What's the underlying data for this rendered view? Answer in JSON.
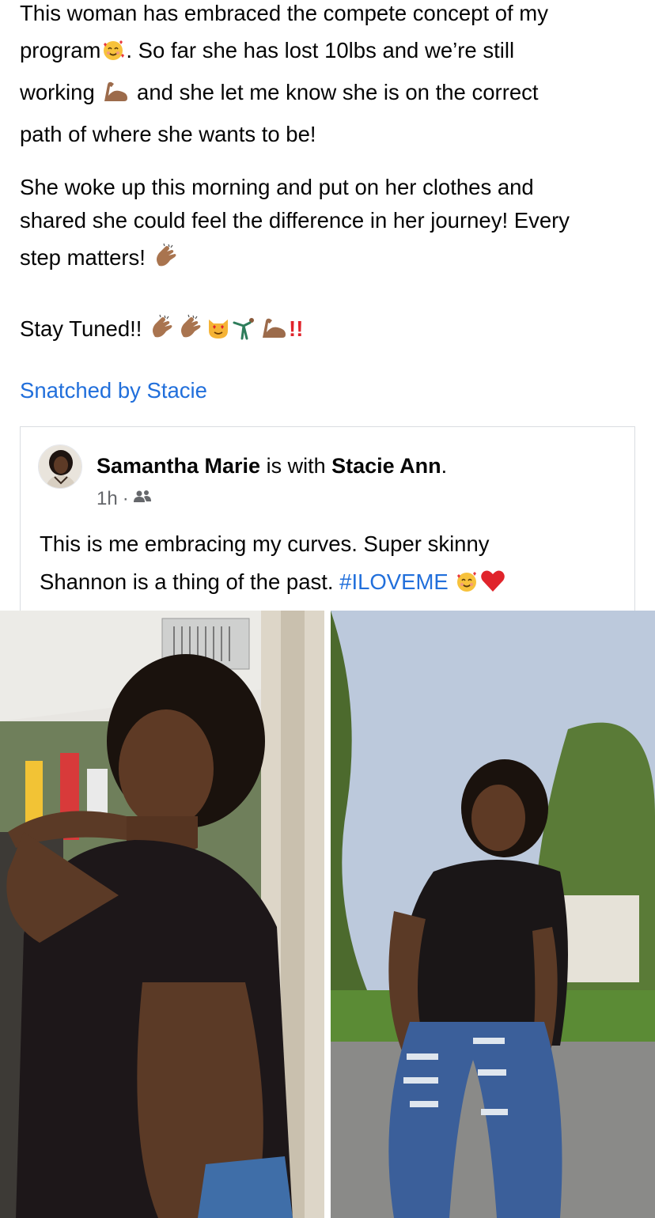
{
  "post": {
    "line1": "This woman has embraced the compete concept of my",
    "line2a": "program",
    "line2b": ". So far she has lost 10lbs and we’re still",
    "line3a": "working ",
    "line3b": " and she let me know she is on the correct",
    "line4": "path of where she wants to be!",
    "line5": "She woke up this morning and put on her clothes and",
    "line6": "shared she could feel the difference in her journey! Every",
    "line7": "step matters! ",
    "line8": "Stay Tuned!! ",
    "line8_end": "!!"
  },
  "page_link": "Snatched by Stacie",
  "shared": {
    "author": "Samantha Marie",
    "with_text": " is with ",
    "tagged": "Stacie Ann",
    "period": ".",
    "time": "1h",
    "separator": "·",
    "text_line1": "This is me embracing my curves. Super skinny",
    "text_line2": "Shannon is a thing of the past. ",
    "hashtag": "#ILOVEME"
  },
  "icons": {
    "smiling_hearts": "smiling-face-with-hearts-icon",
    "flexed_bicep": "flexed-bicep-icon",
    "clapping_hands": "clapping-hands-icon",
    "heart_eyes_cat": "heart-eyes-cat-icon",
    "cartwheel": "person-cartwheeling-icon",
    "red_heart": "red-heart-icon",
    "friends_audience": "friends-audience-icon"
  },
  "colors": {
    "link": "#216fdb",
    "text": "#050505",
    "secondary": "#65676b",
    "card_border": "#dadde1"
  }
}
